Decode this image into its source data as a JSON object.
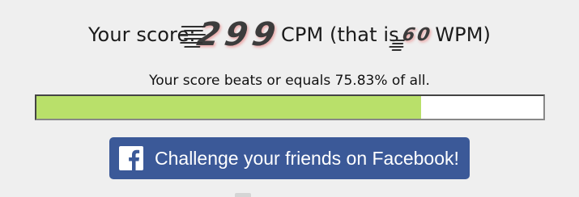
{
  "score": {
    "prefix": "Your score:",
    "cpm_value": "299",
    "cpm_unit": "CPM (that is",
    "wpm_value": "60",
    "wpm_unit": "WPM)"
  },
  "percentile": {
    "text": "Your score beats or equals 75.83% of all.",
    "fraction": 0.7583
  },
  "facebook_button": {
    "label": "Challenge your friends on Facebook!"
  },
  "colors": {
    "progress_fill": "#b9e06a",
    "facebook_blue": "#3b5998",
    "background": "#efefef"
  },
  "icons": [
    "facebook-icon"
  ]
}
